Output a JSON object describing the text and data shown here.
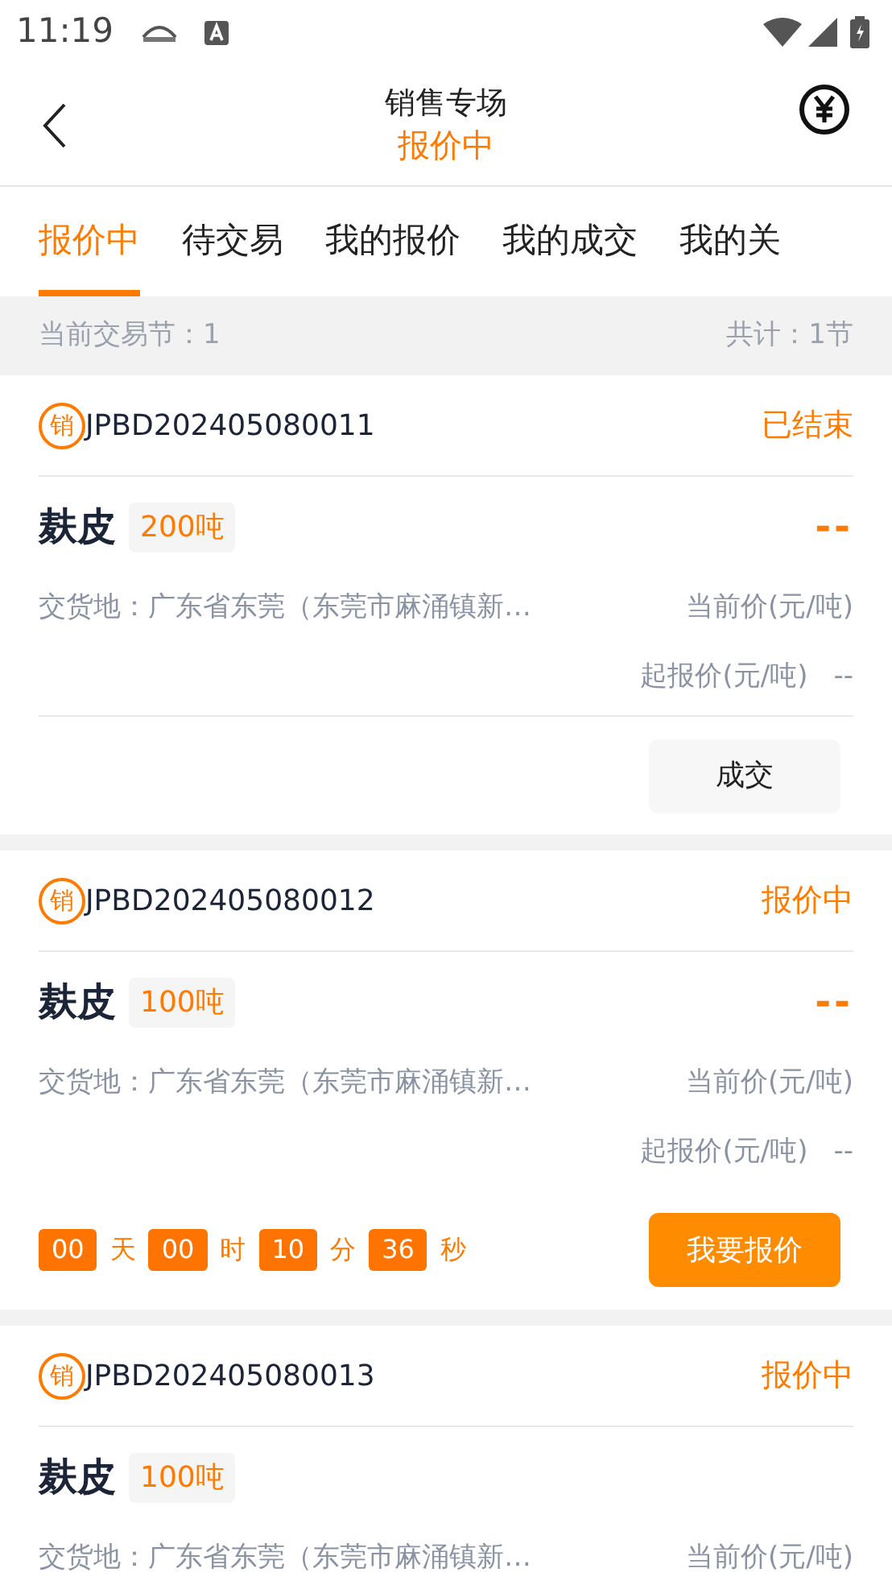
{
  "status_bar": {
    "time": "11:19"
  },
  "header": {
    "title": "销售专场",
    "subtitle": "报价中"
  },
  "tabs": [
    {
      "label": "报价中",
      "selected": true
    },
    {
      "label": "待交易",
      "selected": false
    },
    {
      "label": "我的报价",
      "selected": false
    },
    {
      "label": "我的成交",
      "selected": false
    },
    {
      "label": "我的关",
      "selected": false
    }
  ],
  "info_bar": {
    "session": "当前交易节：1",
    "total": "共计：1节"
  },
  "listings": [
    {
      "badge": "销",
      "code": "JPBD202405080011",
      "status": "已结束",
      "product": "麸皮",
      "quantity": "200吨",
      "price": "--",
      "address": "交货地：广东省东莞（东莞市麻涌镇新…",
      "current_price_label": "当前价(元/吨)",
      "start_price_label": "起报价(元/吨)",
      "start_price": "--",
      "footer": {
        "kind": "deal",
        "button": "成交"
      }
    },
    {
      "badge": "销",
      "code": "JPBD202405080012",
      "status": "报价中",
      "product": "麸皮",
      "quantity": "100吨",
      "price": "--",
      "address": "交货地：广东省东莞（东莞市麻涌镇新…",
      "current_price_label": "当前价(元/吨)",
      "start_price_label": "起报价(元/吨)",
      "start_price": "--",
      "footer": {
        "kind": "countdown",
        "countdown": [
          {
            "value": "00",
            "unit": "天"
          },
          {
            "value": "00",
            "unit": "时"
          },
          {
            "value": "10",
            "unit": "分"
          },
          {
            "value": "36",
            "unit": "秒"
          }
        ],
        "button": "我要报价"
      }
    },
    {
      "badge": "销",
      "code": "JPBD202405080013",
      "status": "报价中",
      "product": "麸皮",
      "quantity": "100吨",
      "address": "交货地：广东省东莞（东莞市麻涌镇新…",
      "current_price_label": "当前价(元/吨)"
    }
  ]
}
